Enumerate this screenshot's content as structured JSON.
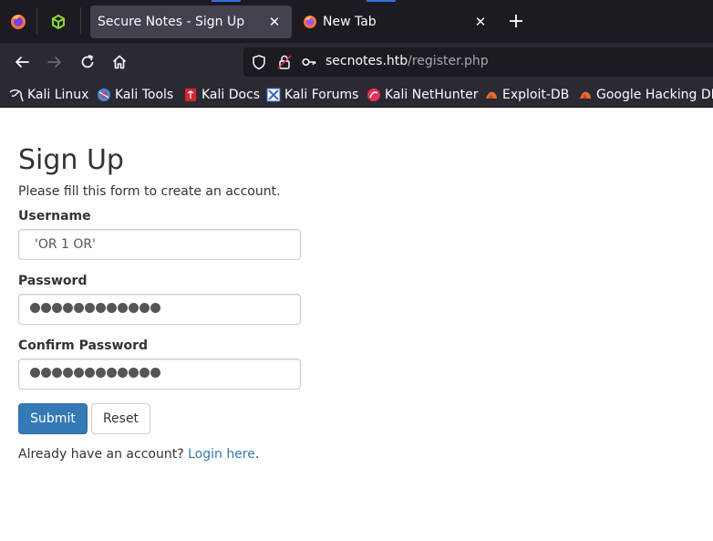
{
  "browser": {
    "tabs": [
      {
        "title": "Secure Notes - Sign Up",
        "active": true
      },
      {
        "title": "New Tab",
        "active": false
      }
    ],
    "new_tab_symbol": "+",
    "close_symbol": "✕",
    "url": {
      "host": "secnotes.htb",
      "path": "/register.php"
    },
    "bookmarks": [
      {
        "label": "Kali Linux",
        "icon": "kali-dragon-icon"
      },
      {
        "label": "Kali Tools",
        "icon": "kali-tools-icon"
      },
      {
        "label": "Kali Docs",
        "icon": "kali-docs-icon"
      },
      {
        "label": "Kali Forums",
        "icon": "kali-forums-icon"
      },
      {
        "label": "Kali NetHunter",
        "icon": "kali-nethunter-icon"
      },
      {
        "label": "Exploit-DB",
        "icon": "exploit-db-icon"
      },
      {
        "label": "Google Hacking DB",
        "icon": "google-hacking-db-icon"
      }
    ]
  },
  "form": {
    "heading": "Sign Up",
    "lead": "Please fill this form to create an account.",
    "username_label": "Username",
    "username_value": "'OR 1 OR'",
    "password_label": "Password",
    "confirm_label": "Confirm Password",
    "password_mask_count": 12,
    "confirm_mask_count": 12,
    "submit_label": "Submit",
    "reset_label": "Reset",
    "footer_text": "Already have an account?",
    "login_link": "Login here",
    "footer_period": "."
  },
  "colors": {
    "primary": "#337ab7",
    "tab_bg": "#1c1b22",
    "toolbar_bg": "#2b2a33",
    "active_tab": "#42414d"
  }
}
